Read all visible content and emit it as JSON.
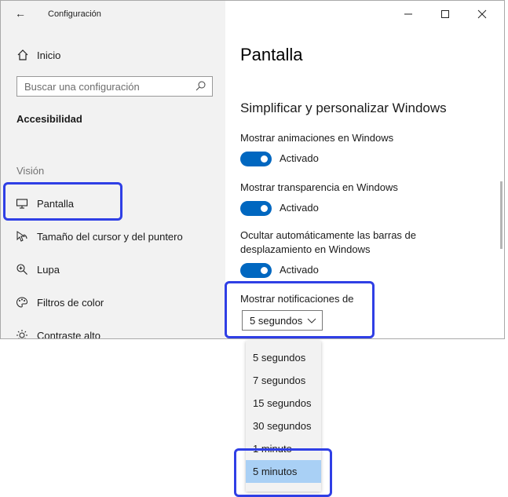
{
  "window": {
    "title": "Configuración",
    "controls": [
      "minimize-icon",
      "maximize-icon",
      "close-icon"
    ]
  },
  "sidebar": {
    "home_label": "Inicio",
    "search_placeholder": "Buscar una configuración",
    "section_title": "Accesibilidad",
    "group_label": "Visión",
    "items": [
      {
        "label": "Pantalla",
        "icon": "monitor-icon",
        "selected": true
      },
      {
        "label": "Tamaño del cursor y del puntero",
        "icon": "cursor-icon"
      },
      {
        "label": "Lupa",
        "icon": "magnifier-icon"
      },
      {
        "label": "Filtros de color",
        "icon": "palette-icon"
      },
      {
        "label": "Contraste alto",
        "icon": "sun-icon"
      }
    ]
  },
  "main": {
    "page_title": "Pantalla",
    "subheading": "Simplificar y personalizar Windows",
    "options": [
      {
        "label": "Mostrar animaciones en Windows",
        "state": "Activado"
      },
      {
        "label": "Mostrar transparencia en Windows",
        "state": "Activado"
      },
      {
        "label": "Ocultar automáticamente las barras de desplazamiento en Windows",
        "state": "Activado"
      }
    ],
    "notifications_label": "Mostrar notificaciones de",
    "notifications_value": "5 segundos"
  },
  "dropdown": {
    "options": [
      "5 segundos",
      "7 segundos",
      "15 segundos",
      "30 segundos",
      "1 minuto",
      "5 minutos"
    ],
    "selected": "5 minutos"
  },
  "colors": {
    "accent": "#0067c0",
    "highlight_box": "#2f3fe5",
    "selected_option": "#a9d0f5"
  }
}
